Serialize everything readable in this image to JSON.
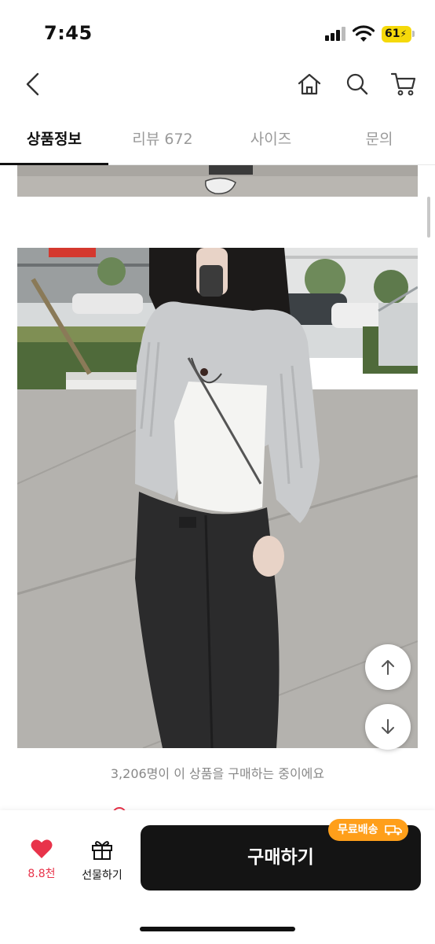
{
  "status_bar": {
    "time": "7:45",
    "battery": "61"
  },
  "nav": {
    "back_icon": "chevron-left-icon",
    "home_icon": "home-icon",
    "search_icon": "search-icon",
    "cart_icon": "cart-icon"
  },
  "tabs": [
    {
      "label": "상품정보",
      "active": true
    },
    {
      "label": "리뷰 672",
      "active": false
    },
    {
      "label": "사이즈",
      "active": false
    },
    {
      "label": "문의",
      "active": false
    }
  ],
  "content": {
    "purchase_notice": "3,206명이 이 상품을 구매하는 중이에요"
  },
  "floating": {
    "up_icon": "arrow-up-icon",
    "down_icon": "arrow-down-icon"
  },
  "bottom_bar": {
    "like_count": "8.8천",
    "gift_label": "선물하기",
    "buy_label": "구매하기",
    "free_shipping_badge": "무료배송"
  },
  "colors": {
    "accent_red": "#e8334a",
    "badge_orange": "#ff9f1a",
    "buy_button": "#141414"
  }
}
